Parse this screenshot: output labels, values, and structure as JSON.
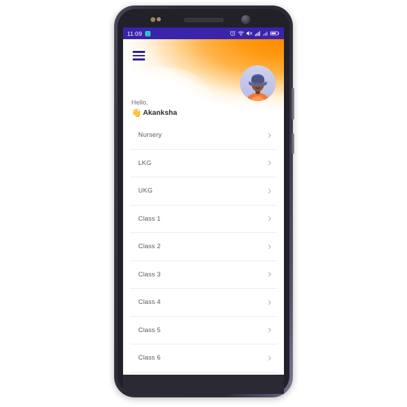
{
  "device": {
    "hardware": {
      "sensor_dot_1": "proximity-sensor",
      "sensor_dot_2": "light-sensor",
      "earpiece": "earpiece-speaker",
      "front_camera": "front-camera",
      "side_button_volume": "volume-rocker",
      "side_button_power": "power-button"
    }
  },
  "status_bar": {
    "time": "11:09",
    "app_icon": "notification-app-icon",
    "background_color": "#3a23ad",
    "icons": [
      "alarm-icon",
      "wifi-icon",
      "mute-icon",
      "signal-bars-icon",
      "signal-bars-secondary-icon",
      "battery-icon"
    ]
  },
  "header": {
    "menu_icon": "hamburger-menu-icon",
    "avatar": "user-avatar",
    "greeting": "Hello,",
    "wave_emoji": "👋",
    "user_name": "Akanksha",
    "accent_color": "#ff8a00",
    "menu_color": "#2b2194"
  },
  "class_list": {
    "items": [
      {
        "label": "Nursery",
        "chevron": "chevron-right-icon"
      },
      {
        "label": "LKG",
        "chevron": "chevron-right-icon"
      },
      {
        "label": "UKG",
        "chevron": "chevron-right-icon"
      },
      {
        "label": "Class 1",
        "chevron": "chevron-right-icon"
      },
      {
        "label": "Class 2",
        "chevron": "chevron-right-icon"
      },
      {
        "label": "Class 3",
        "chevron": "chevron-right-icon"
      },
      {
        "label": "Class 4",
        "chevron": "chevron-right-icon"
      },
      {
        "label": "Class 5",
        "chevron": "chevron-right-icon"
      },
      {
        "label": "Class 6",
        "chevron": "chevron-right-icon"
      }
    ]
  }
}
